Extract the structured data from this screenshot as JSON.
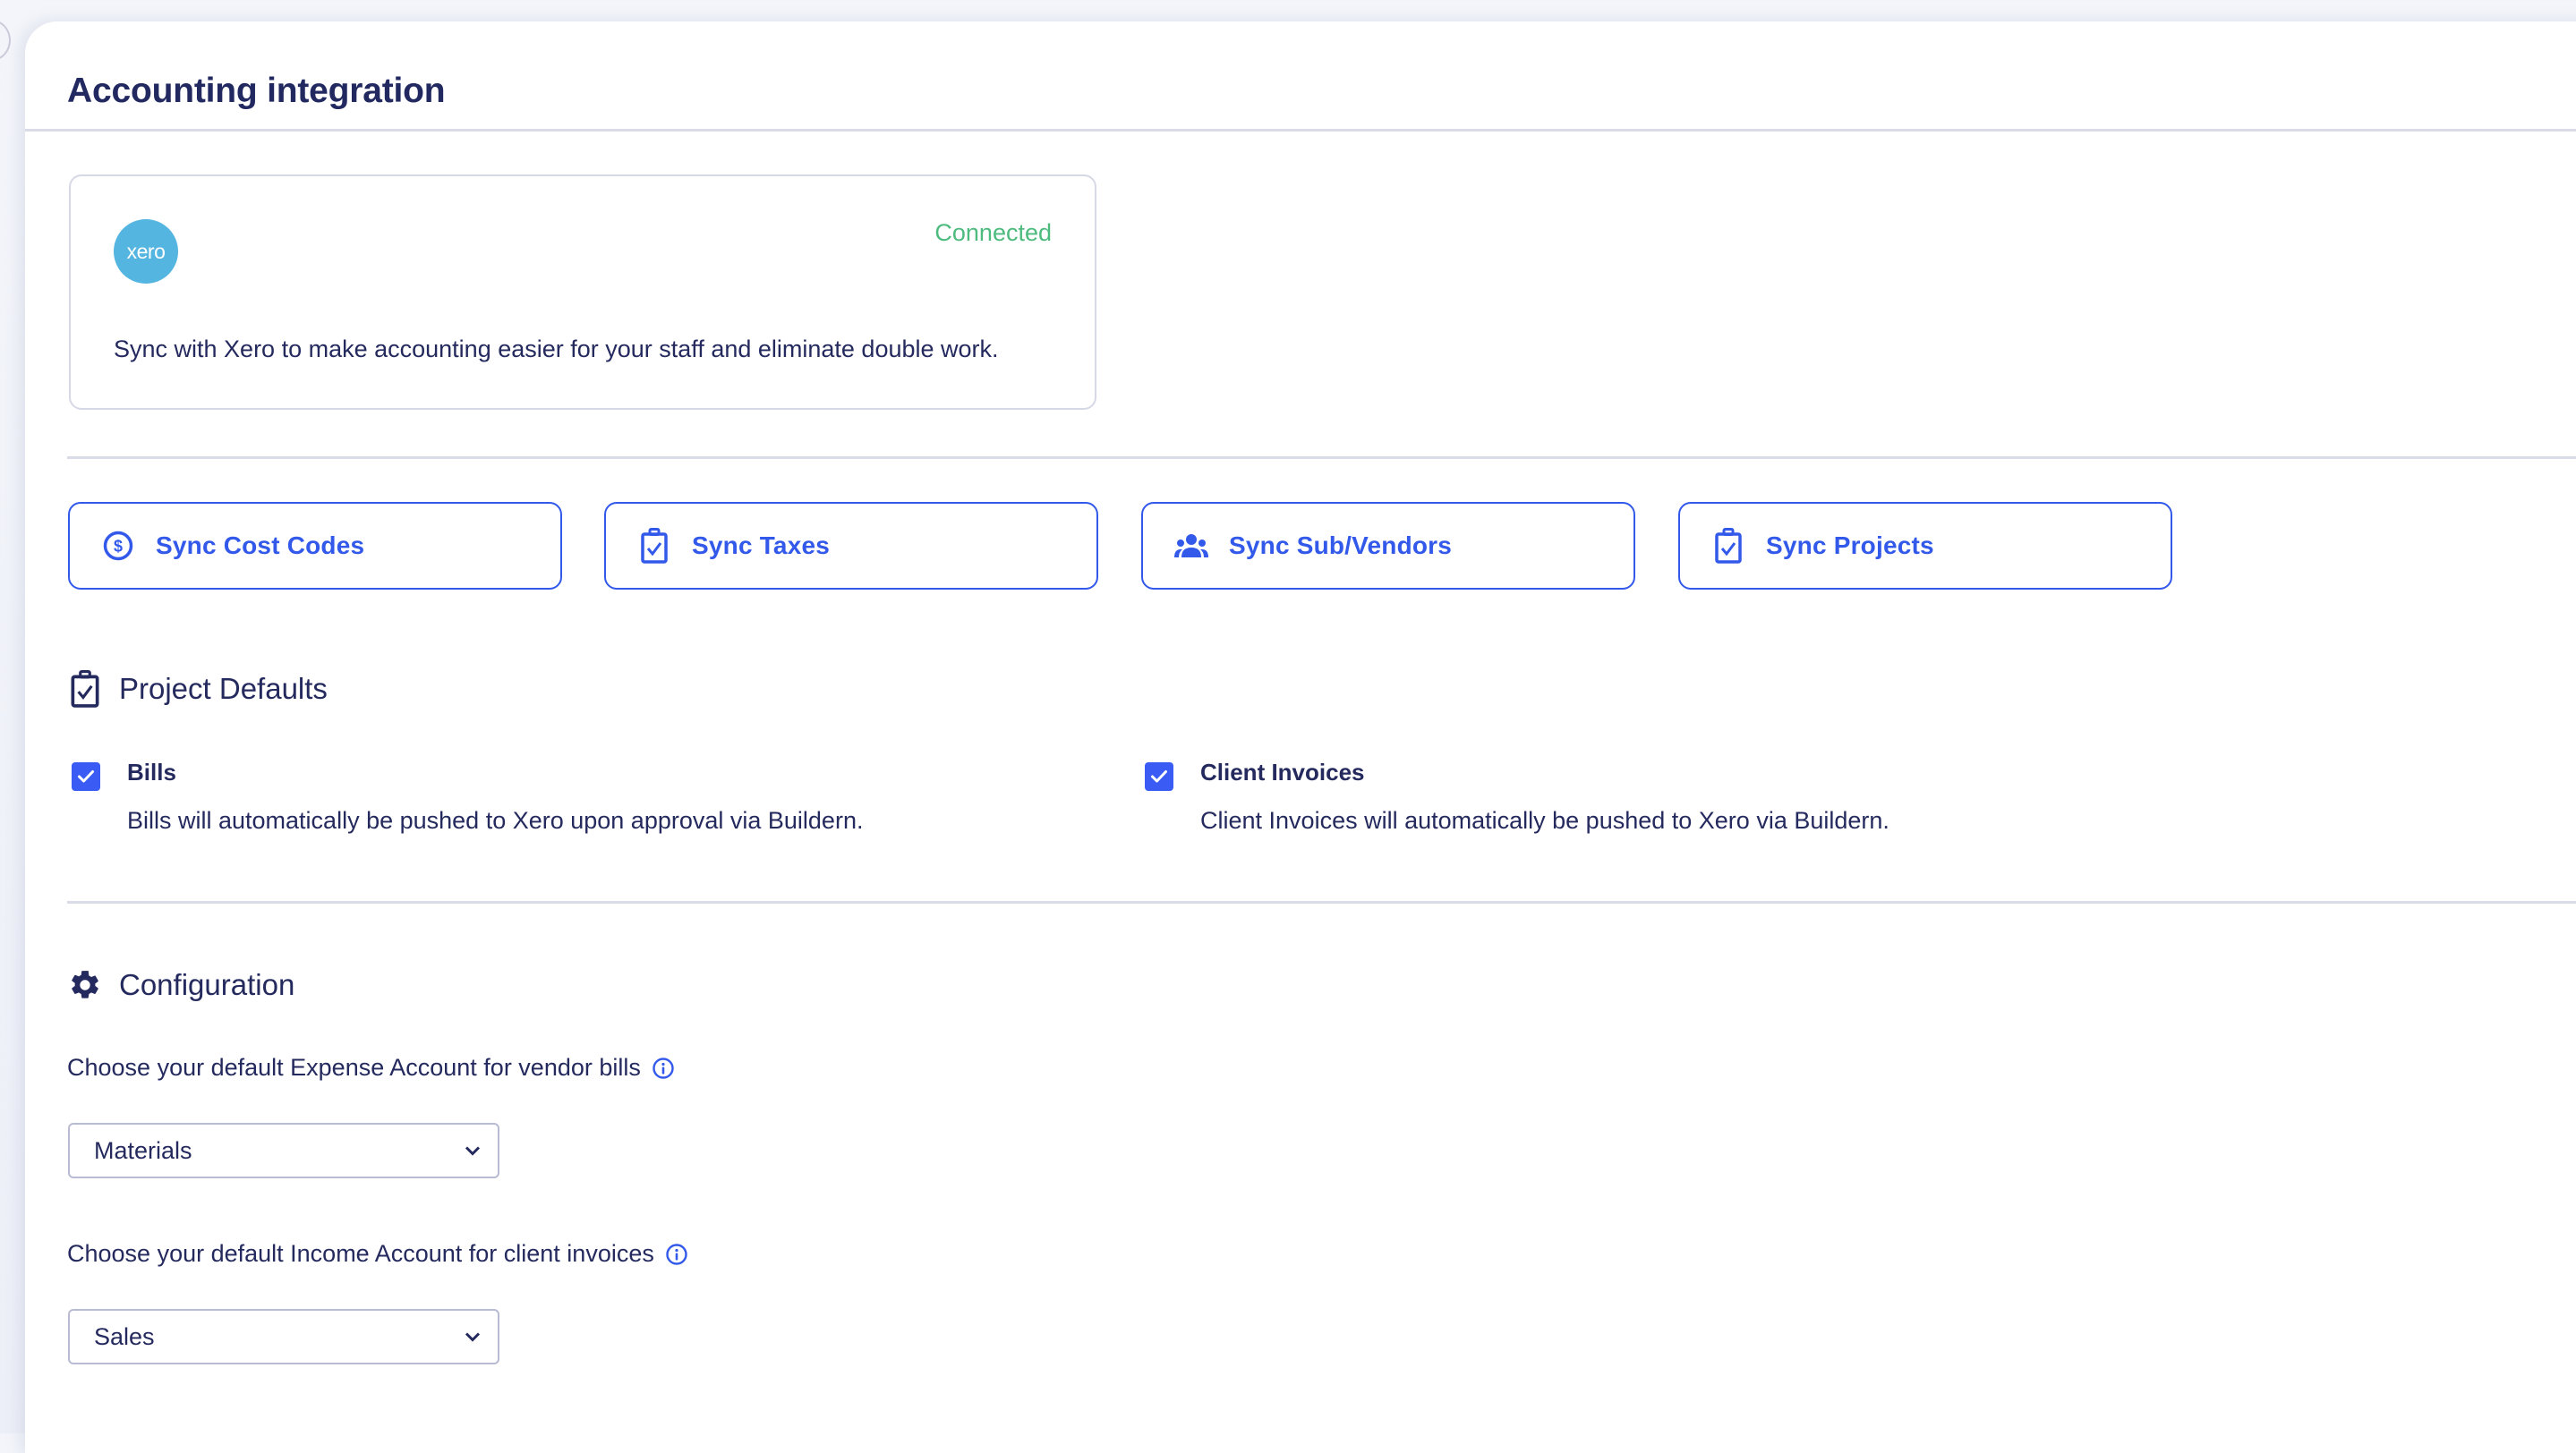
{
  "header": {
    "title": "Accounting integration"
  },
  "integration": {
    "logo_text": "xero",
    "status": "Connected",
    "status_color": "#4DBB7E",
    "description": "Sync with Xero to make accounting easier for your staff and eliminate double work."
  },
  "sync_buttons": [
    {
      "label": "Sync Cost Codes",
      "icon": "dollar-circle-icon"
    },
    {
      "label": "Sync Taxes",
      "icon": "clipboard-check-icon"
    },
    {
      "label": "Sync Sub/Vendors",
      "icon": "users-icon"
    },
    {
      "label": "Sync Projects",
      "icon": "clipboard-check-icon"
    }
  ],
  "project_defaults": {
    "title": "Project Defaults",
    "icon": "clipboard-check-icon",
    "items": [
      {
        "label": "Bills",
        "checked": true,
        "description": "Bills will automatically be pushed to Xero upon approval via Buildern."
      },
      {
        "label": "Client Invoices",
        "checked": true,
        "description": "Client Invoices will automatically be pushed to Xero via Buildern."
      }
    ]
  },
  "configuration": {
    "title": "Configuration",
    "icon": "gear-icon",
    "fields": [
      {
        "label": "Choose your default Expense Account for vendor bills",
        "value": "Materials"
      },
      {
        "label": "Choose your default Income Account for client invoices",
        "value": "Sales"
      }
    ]
  },
  "colors": {
    "accent": "#3259EA",
    "text": "#242A5E",
    "checkbox": "#3A5CF5",
    "connected": "#4DBB7E",
    "xero_brand": "#54B5E0"
  }
}
